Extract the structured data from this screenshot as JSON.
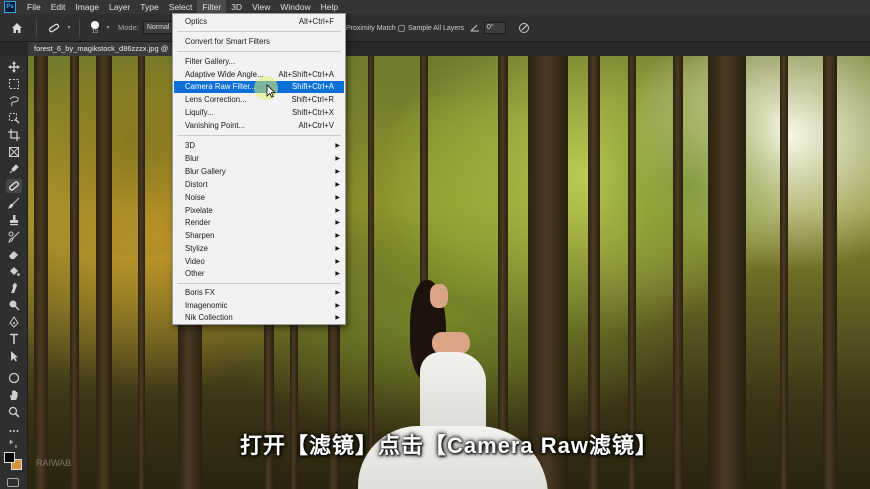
{
  "menubar": {
    "logo": "Ps",
    "items": [
      "File",
      "Edit",
      "Image",
      "Layer",
      "Type",
      "Select",
      "Filter",
      "3D",
      "View",
      "Window",
      "Help"
    ],
    "active": "Filter"
  },
  "options_bar": {
    "brush_size": "15",
    "mode_label": "Mode:",
    "mode_value": "Normal",
    "proximity_match": "Proximity Match",
    "sample_all_layers": "Sample All Layers",
    "angle_value": "0°"
  },
  "document": {
    "tab_title": "forest_6_by_magikstock_d86zzzx.jpg @",
    "close_glyph": "×"
  },
  "filter_menu": {
    "items": [
      {
        "label": "Optics",
        "shortcut": "Alt+Ctrl+F"
      },
      {
        "label": "Convert for Smart Filters",
        "shortcut": ""
      },
      {
        "label": "Filter Gallery...",
        "shortcut": ""
      },
      {
        "label": "Adaptive Wide Angle...",
        "shortcut": "Alt+Shift+Ctrl+A"
      },
      {
        "label": "Camera Raw Filter...",
        "shortcut": "Shift+Ctrl+A"
      },
      {
        "label": "Lens Correction...",
        "shortcut": "Shift+Ctrl+R"
      },
      {
        "label": "Liquify...",
        "shortcut": "Shift+Ctrl+X"
      },
      {
        "label": "Vanishing Point...",
        "shortcut": "Alt+Ctrl+V"
      },
      {
        "label": "3D",
        "submenu": true
      },
      {
        "label": "Blur",
        "submenu": true
      },
      {
        "label": "Blur Gallery",
        "submenu": true
      },
      {
        "label": "Distort",
        "submenu": true
      },
      {
        "label": "Noise",
        "submenu": true
      },
      {
        "label": "Pixelate",
        "submenu": true
      },
      {
        "label": "Render",
        "submenu": true
      },
      {
        "label": "Sharpen",
        "submenu": true
      },
      {
        "label": "Stylize",
        "submenu": true
      },
      {
        "label": "Video",
        "submenu": true
      },
      {
        "label": "Other",
        "submenu": true
      },
      {
        "label": "Boris FX",
        "submenu": true
      },
      {
        "label": "Imagenomic",
        "submenu": true
      },
      {
        "label": "Nik Collection",
        "submenu": true
      }
    ],
    "highlighted": "Camera Raw Filter...",
    "submenu_arrow": "▶"
  },
  "canvas": {
    "subtitle": "打开【滤镜】点击【Camera Raw滤镜】",
    "watermark": "RAIWAB"
  },
  "colors": {
    "foreground": "#000000",
    "background": "#d9913e",
    "menu_highlight": "#0a70d8"
  }
}
